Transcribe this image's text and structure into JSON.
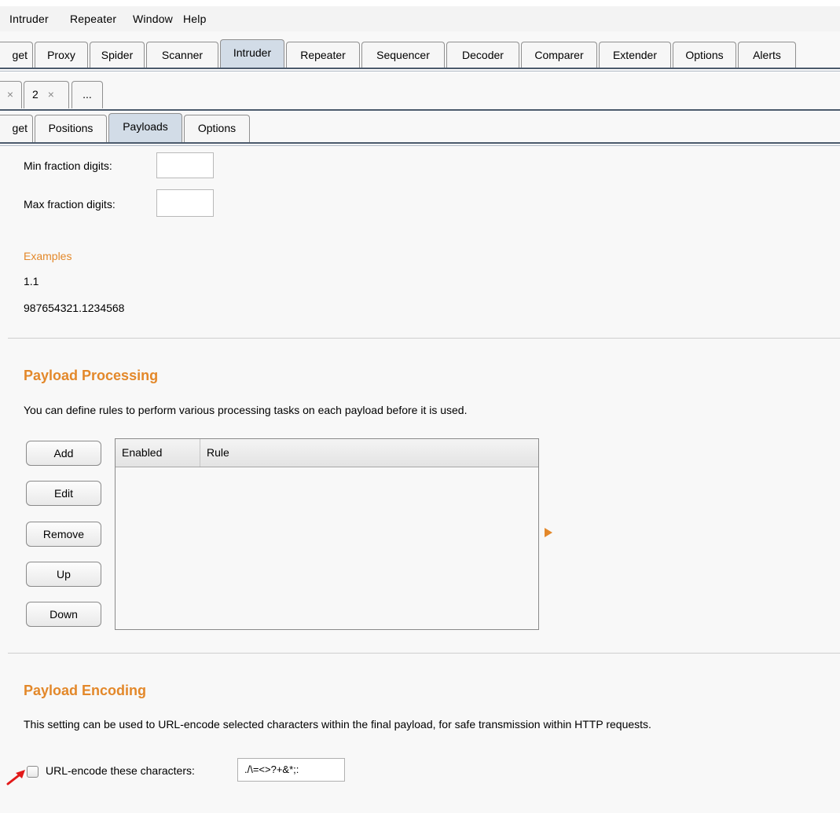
{
  "menu": [
    "Intruder",
    "Repeater",
    "Window",
    "Help"
  ],
  "main_tabs": [
    "get",
    "Proxy",
    "Spider",
    "Scanner",
    "Intruder",
    "Repeater",
    "Sequencer",
    "Decoder",
    "Comparer",
    "Extender",
    "Options",
    "Alerts"
  ],
  "main_tabs_selected": "Intruder",
  "attack_tabs": {
    "close_glyph": "×",
    "tab2": "2",
    "more": "..."
  },
  "sub_tabs": [
    "get",
    "Positions",
    "Payloads",
    "Options"
  ],
  "sub_tabs_selected": "Payloads",
  "number_format": {
    "min_fraction_label": "Min fraction digits:",
    "min_fraction_value": "",
    "max_fraction_label": "Max fraction digits:",
    "max_fraction_value": ""
  },
  "examples": {
    "title": "Examples",
    "values": [
      "1.1",
      "987654321.1234568"
    ]
  },
  "payload_processing": {
    "title": "Payload Processing",
    "description": "You can define rules to perform various processing tasks on each payload before it is used.",
    "buttons": [
      "Add",
      "Edit",
      "Remove",
      "Up",
      "Down"
    ],
    "columns": [
      "Enabled",
      "Rule"
    ],
    "rows": []
  },
  "payload_encoding": {
    "title": "Payload Encoding",
    "description": "This setting can be used to URL-encode selected characters within the final payload, for safe transmission within HTTP requests.",
    "checkbox_label": "URL-encode these characters:",
    "checkbox_checked": false,
    "characters": "./\\=<>?+&*;:"
  },
  "colors": {
    "accent_orange": "#e3882a",
    "selected_tab": "#d2dce7",
    "rule_dark": "#4b5a6c"
  }
}
